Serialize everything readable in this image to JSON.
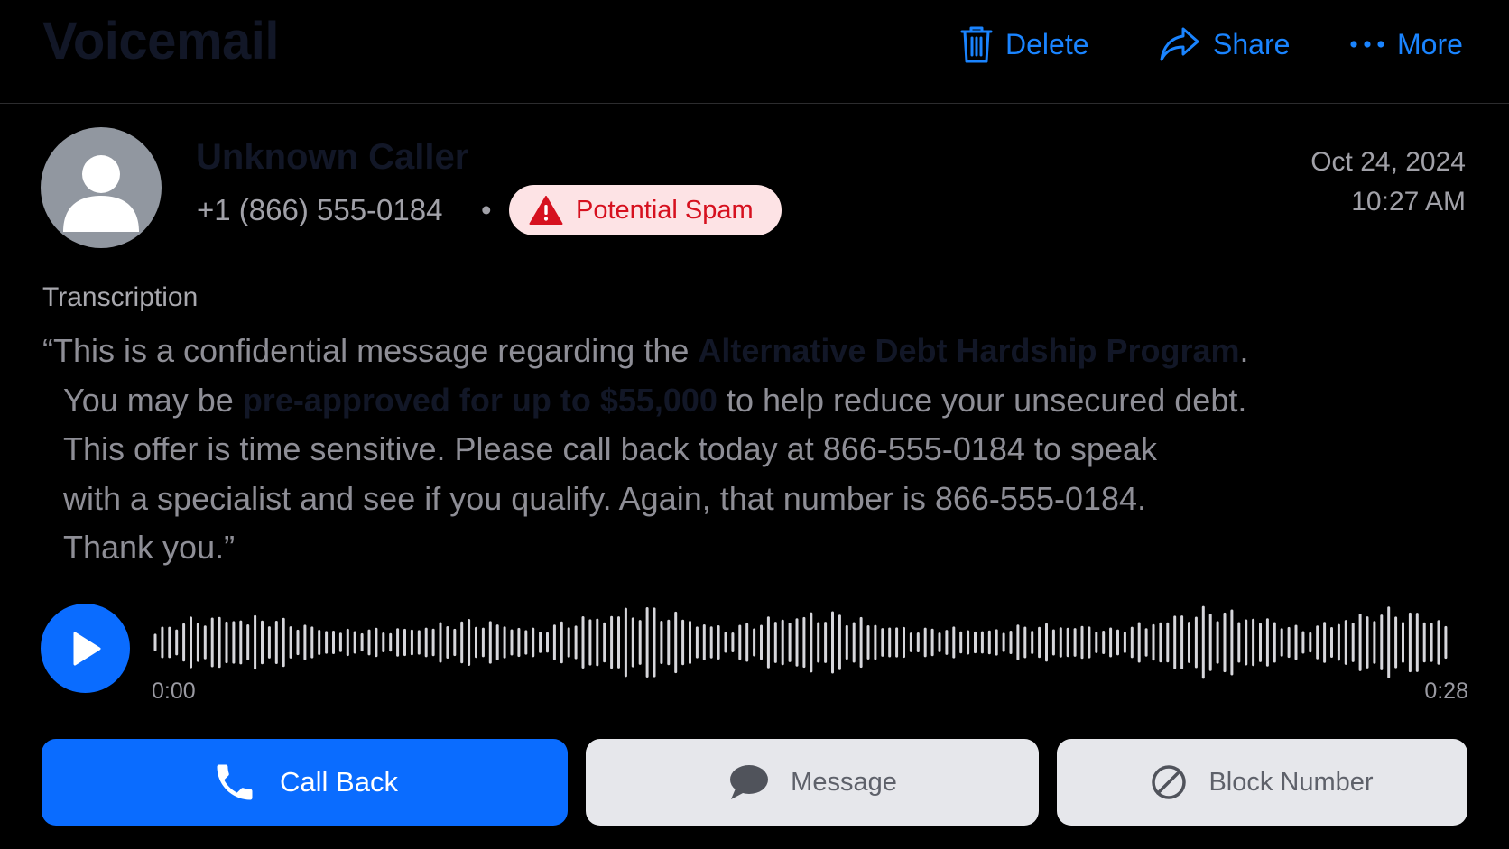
{
  "header": {
    "title": "Voicemail",
    "actions": {
      "delete": {
        "label": "Delete",
        "icon": "trash-icon"
      },
      "share": {
        "label": "Share",
        "icon": "share-arrow-icon"
      },
      "more": {
        "label": "More",
        "icon": "ellipsis-icon"
      }
    }
  },
  "caller": {
    "name": "Unknown Caller",
    "number": "+1 (866) 555-0184",
    "separator": "•",
    "avatar_icon": "person-avatar-icon",
    "badge": {
      "label": "Potential Spam",
      "icon": "warning-triangle-icon"
    },
    "date": "Oct 24, 2024",
    "time": "10:27 AM"
  },
  "transcription": {
    "label": "Transcription",
    "line1": {
      "pre": "“This is a confidential message regarding the ",
      "highlight": "Alternative Debt Hardship Program",
      "post": "."
    },
    "line2": {
      "pre": "You may be ",
      "highlight": "pre-approved for up to $55,000",
      "post": " to help reduce your unsecured debt."
    },
    "line3": "This offer is time sensitive. Please call back today at 866-555-0184 to speak",
    "line4": "with a specialist and see if you qualify. Again, that number is 866-555-0184.",
    "line5": "Thank you.”"
  },
  "player": {
    "play_icon": "play-icon",
    "current_time": "0:00",
    "duration": "0:28",
    "progress": 0
  },
  "buttons": {
    "call_back": {
      "label": "Call Back",
      "icon": "phone-icon"
    },
    "message": {
      "label": "Message",
      "icon": "chat-bubble-icon"
    },
    "block": {
      "label": "Block Number",
      "icon": "block-icon"
    }
  },
  "colors": {
    "accent": "#0a6cff",
    "link": "#1a84ff",
    "spam_text": "#d6111f",
    "spam_bg": "#fde3e5",
    "background": "#000000"
  }
}
